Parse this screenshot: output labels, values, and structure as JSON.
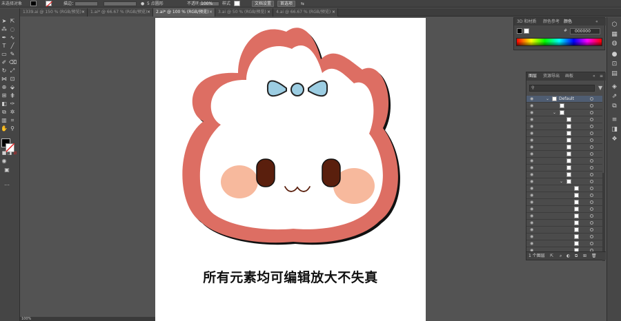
{
  "control_bar": {
    "selection_label": "未选择对象",
    "stroke_label": "描边：",
    "brush_label": "5 点圆形",
    "opacity_label": "不透明度",
    "opacity_value": "100%",
    "style_label": "样式",
    "doc_setup_button": "文档设置",
    "prefs_button": "首选项"
  },
  "tabs": [
    {
      "label": "1339.ai @ 150 % (RGB/预览)",
      "close": "×"
    },
    {
      "label": "1.ai* @ 66.67 % (RGB/预览)",
      "close": "×"
    },
    {
      "label": "2.ai* @ 100 % (RGB/预览)",
      "close": "×"
    },
    {
      "label": "3.ai @ 50 % (RGB/预览)",
      "close": "×"
    },
    {
      "label": "4.ai @ 66.67 % (RGB/预览)",
      "close": "×"
    }
  ],
  "artboard": {
    "caption": "所有元素均可编辑放大不失真"
  },
  "color_panel": {
    "tabs": [
      "3D 和材质",
      "颜色参考",
      "颜色"
    ],
    "active_tab": "颜色",
    "hex_label": "#",
    "hex_value": "000000",
    "collapse": "«"
  },
  "layers_panel": {
    "tabs": [
      "图层",
      "资源导出",
      "画板"
    ],
    "active_tab": "图层",
    "top_layer_name": "Default",
    "footer_count": "1 个图层",
    "collapse": "«",
    "menu": "≡"
  },
  "status_bar": {
    "zoom": "100%"
  },
  "colors": {
    "bunny_border": "#dd6e63",
    "bow": "#9ccde2",
    "cheek": "#f7b99d",
    "eye": "#5a1f0d",
    "selection_blue": "#4f5d72"
  }
}
